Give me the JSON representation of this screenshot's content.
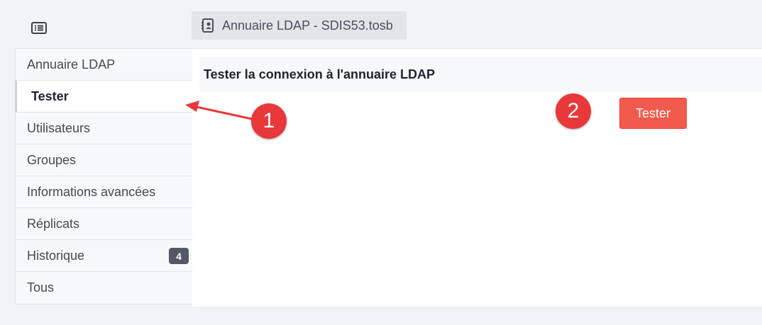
{
  "toolbar": {
    "menu_icon": "list-icon",
    "tab_icon": "contact-card-icon",
    "tab_title": "Annuaire LDAP - SDIS53.tosb"
  },
  "sidebar": {
    "items": [
      {
        "label": "Annuaire LDAP",
        "active": false
      },
      {
        "label": "Tester",
        "active": true
      },
      {
        "label": "Utilisateurs",
        "active": false
      },
      {
        "label": "Groupes",
        "active": false
      },
      {
        "label": "Informations avancées",
        "active": false
      },
      {
        "label": "Réplicats",
        "active": false
      },
      {
        "label": "Historique",
        "active": false,
        "badge": "4"
      },
      {
        "label": "Tous",
        "active": false
      }
    ]
  },
  "main": {
    "section_title": "Tester la connexion à l'annuaire LDAP",
    "test_button_label": "Tester"
  },
  "annotations": {
    "callout_1": "1",
    "callout_2": "2",
    "callout_color": "#e8383a"
  },
  "colors": {
    "button_bg": "#f25a4e",
    "badge_bg": "#525866"
  }
}
